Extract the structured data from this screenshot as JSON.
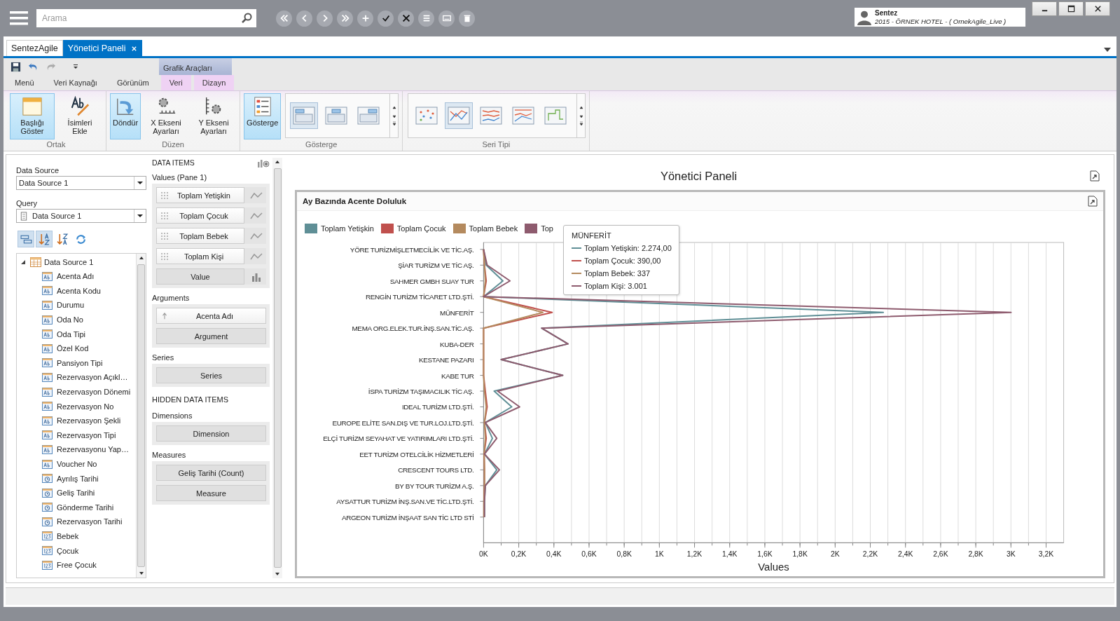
{
  "top_bar": {
    "search": {
      "placeholder": "Arama"
    },
    "tools": [
      {
        "kind": "first"
      },
      {
        "kind": "prev"
      },
      {
        "kind": "next"
      },
      {
        "kind": "last"
      },
      {
        "kind": "add"
      },
      {
        "kind": "save"
      },
      {
        "kind": "cancel"
      },
      {
        "kind": "list"
      },
      {
        "kind": "keyboard"
      },
      {
        "kind": "delete"
      }
    ],
    "user": {
      "name": "Sentez",
      "detail": "2015 - ÖRNEK HOTEL - ( OrnekAgile_Live )"
    }
  },
  "doc_tabs": [
    {
      "label": "SentezAgile",
      "selected": false,
      "closable": false
    },
    {
      "label": "Yönetici Paneli",
      "selected": true,
      "closable": true
    }
  ],
  "ribbon": {
    "contextual_group": "Grafik Araçları",
    "tabs": [
      {
        "label": "Menü",
        "contextual": false,
        "selected": false
      },
      {
        "label": "Veri Kaynağı",
        "contextual": false,
        "selected": false
      },
      {
        "label": "Görünüm",
        "contextual": false,
        "selected": false
      },
      {
        "label": "Veri",
        "contextual": true,
        "selected": false
      },
      {
        "label": "Dizayn",
        "contextual": true,
        "selected": false
      }
    ],
    "groups": [
      {
        "label": "Ortak",
        "buttons": [
          {
            "label": "Başlığı Göster",
            "kind": "title",
            "selected": true
          },
          {
            "label": "İsimleri Ekle",
            "kind": "rename",
            "selected": false
          }
        ]
      },
      {
        "label": "Düzen",
        "buttons": [
          {
            "label": "Döndür",
            "kind": "rotate",
            "selected": true
          },
          {
            "label": "X Ekseni Ayarları",
            "kind": "xaxis",
            "selected": false
          },
          {
            "label": "Y Ekseni Ayarları",
            "kind": "yaxis",
            "selected": false
          }
        ]
      },
      {
        "label": "Gösterge",
        "buttons": [
          {
            "label": "Gösterge",
            "kind": "legend",
            "selected": true
          }
        ],
        "gallery": [
          {
            "kind": "left",
            "selected": true
          },
          {
            "kind": "center",
            "selected": false
          },
          {
            "kind": "right",
            "selected": false
          }
        ]
      },
      {
        "label": "Seri Tipi",
        "gallery": [
          {
            "kind": "point",
            "selected": false
          },
          {
            "kind": "line",
            "selected": true
          },
          {
            "kind": "stacked",
            "selected": false
          },
          {
            "kind": "fullstacked",
            "selected": false
          },
          {
            "kind": "step",
            "selected": false
          }
        ]
      }
    ]
  },
  "data_source_panel": {
    "source_label": "Data Source",
    "source_value": "Data Source 1",
    "query_label": "Query",
    "query_value": "Data Source 1",
    "tools": [
      {
        "kind": "group",
        "selected": true
      },
      {
        "kind": "sortaz",
        "selected": true
      },
      {
        "kind": "sortza",
        "selected": false
      },
      {
        "kind": "refresh",
        "selected": false
      }
    ],
    "tree": {
      "label": "Data Source 1",
      "expanded": true,
      "children": [
        {
          "label": "Acenta Adı",
          "kind": "text"
        },
        {
          "label": "Acenta Kodu",
          "kind": "text"
        },
        {
          "label": "Durumu",
          "kind": "text"
        },
        {
          "label": "Oda No",
          "kind": "text"
        },
        {
          "label": "Oda Tipi",
          "kind": "text"
        },
        {
          "label": "Özel Kod",
          "kind": "text"
        },
        {
          "label": "Pansiyon Tipi",
          "kind": "text"
        },
        {
          "label": "Rezervasyon Açıkl…",
          "kind": "text"
        },
        {
          "label": "Rezervasyon Dönemi",
          "kind": "text"
        },
        {
          "label": "Rezervasyon No",
          "kind": "text"
        },
        {
          "label": "Rezervasyon Şekli",
          "kind": "text"
        },
        {
          "label": "Rezervasyon Tipi",
          "kind": "text"
        },
        {
          "label": "Rezervasyonu Yap…",
          "kind": "text"
        },
        {
          "label": "Voucher No",
          "kind": "text"
        },
        {
          "label": "Ayrılış Tarihi",
          "kind": "date"
        },
        {
          "label": "Geliş Tarihi",
          "kind": "date"
        },
        {
          "label": "Gönderme Tarihi",
          "kind": "date"
        },
        {
          "label": "Rezervasyon Tarihi",
          "kind": "date"
        },
        {
          "label": "Bebek",
          "kind": "number"
        },
        {
          "label": "Çocuk",
          "kind": "number"
        },
        {
          "label": "Free Çocuk",
          "kind": "number"
        }
      ]
    }
  },
  "data_items": {
    "title": "DATA ITEMS",
    "sections": [
      {
        "heading": "Values (Pane 1)",
        "items": [
          {
            "label": "Toplam Yetişkin",
            "kind": "measure"
          },
          {
            "label": "Toplam Çocuk",
            "kind": "measure"
          },
          {
            "label": "Toplam Bebek",
            "kind": "measure"
          },
          {
            "label": "Toplam Kişi",
            "kind": "measure"
          },
          {
            "label": "Value",
            "kind": "valueslot"
          }
        ]
      },
      {
        "heading": "Arguments",
        "items": [
          {
            "label": "Acenta Adı",
            "kind": "sorted"
          },
          {
            "label": "Argument",
            "kind": "slot"
          }
        ]
      },
      {
        "heading": "Series",
        "items": [
          {
            "label": "Series",
            "kind": "slot"
          }
        ]
      },
      {
        "heading": "HIDDEN DATA ITEMS"
      },
      {
        "heading": "Dimensions",
        "items": [
          {
            "label": "Dimension",
            "kind": "slot"
          }
        ]
      },
      {
        "heading": "Measures",
        "items": [
          {
            "label": "Geliş Tarihi (Count)",
            "kind": "slot"
          },
          {
            "label": "Measure",
            "kind": "slot"
          }
        ]
      }
    ]
  },
  "dashboard": {
    "title": "Yönetici Paneli",
    "panel_title": "Ay Bazında Acente Doluluk",
    "legend": [
      {
        "label": "Toplam Yetişkin",
        "color": "#5f8f96"
      },
      {
        "label": "Toplam Çocuk",
        "color": "#c0504d"
      },
      {
        "label": "Toplam Bebek",
        "color": "#b48a5e"
      },
      {
        "label": "Top",
        "color": "#8e5b6e"
      }
    ],
    "tooltip": {
      "title": "MÜNFERİT",
      "values": [
        ": 2.274,00",
        ": 390,00",
        ": 337",
        ": 3.001"
      ]
    },
    "chart_data": {
      "type": "line",
      "orientation": "horizontal",
      "xlabel": "Values",
      "grid": true,
      "categories": [
        "YÖRE TURİZMİŞLETMECİLİK VE TİC.AŞ.",
        "ŞİAR TURİZM VE TİC AŞ.",
        "SAHMER GMBH SUAY TUR",
        "RENGİN TURİZM TİCARET LTD.ŞTİ.",
        "MÜNFERİT",
        "MEMA ORG.ELEK.TUR.İNŞ.SAN.TİC.AŞ.",
        "KUBA-DER",
        "KESTANE PAZARI",
        "KABE TUR",
        "İSPA TURİZM TAŞIMACILIK TİC AŞ.",
        "IDEAL TURİZM LTD.ŞTİ.",
        "EUROPE ELİTE SAN.DIŞ VE TUR.LOJ.LTD.ŞTİ.",
        "ELÇİ TURİZM SEYAHAT VE YATIRIMLARI LTD.ŞTİ.",
        "EET TURİZM OTELCİLİK HİZMETLERİ",
        "CRESCENT TOURS LTD.",
        "BY BY TOUR TURİZM A.Ş.",
        "AYSATTUR TURİZM İNŞ.SAN.VE TİC.LTD.ŞTİ.",
        "ARGEON TURİZM İNŞAAT SAN TİC LTD STİ"
      ],
      "series": [
        {
          "name": "Toplam Yetişkin",
          "color": "#5f8f96",
          "values": [
            0,
            15,
            110,
            0,
            2274,
            330,
            480,
            100,
            450,
            60,
            160,
            10,
            50,
            5,
            75,
            10,
            5,
            5
          ]
        },
        {
          "name": "Toplam Çocuk",
          "color": "#c0504d",
          "values": [
            0,
            5,
            15,
            0,
            390,
            0,
            0,
            0,
            0,
            10,
            20,
            5,
            15,
            3,
            5,
            5,
            2,
            2
          ]
        },
        {
          "name": "Toplam Bebek",
          "color": "#b48a5e",
          "values": [
            0,
            5,
            10,
            0,
            337,
            0,
            0,
            0,
            0,
            5,
            15,
            5,
            10,
            3,
            5,
            5,
            2,
            2
          ]
        },
        {
          "name": "Toplam Kişi",
          "color": "#8e5b6e",
          "values": [
            0,
            20,
            150,
            0,
            3001,
            330,
            480,
            100,
            450,
            80,
            205,
            10,
            75,
            5,
            90,
            10,
            5,
            5
          ]
        }
      ],
      "xlim": [
        0,
        3300
      ],
      "xticks": [
        {
          "value": 0,
          "label": "0K"
        },
        {
          "value": 200,
          "label": "0,2K"
        },
        {
          "value": 400,
          "label": "0,4K"
        },
        {
          "value": 600,
          "label": "0,6K"
        },
        {
          "value": 800,
          "label": "0,8K"
        },
        {
          "value": 1000,
          "label": "1K"
        },
        {
          "value": 1200,
          "label": "1,2K"
        },
        {
          "value": 1400,
          "label": "1,4K"
        },
        {
          "value": 1600,
          "label": "1,6K"
        },
        {
          "value": 1800,
          "label": "1,8K"
        },
        {
          "value": 2000,
          "label": "2K"
        },
        {
          "value": 2200,
          "label": "2,2K"
        },
        {
          "value": 2400,
          "label": "2,4K"
        },
        {
          "value": 2600,
          "label": "2,6K"
        },
        {
          "value": 2800,
          "label": "2,8K"
        },
        {
          "value": 3000,
          "label": "3K"
        },
        {
          "value": 3200,
          "label": "3,2K"
        }
      ]
    }
  }
}
